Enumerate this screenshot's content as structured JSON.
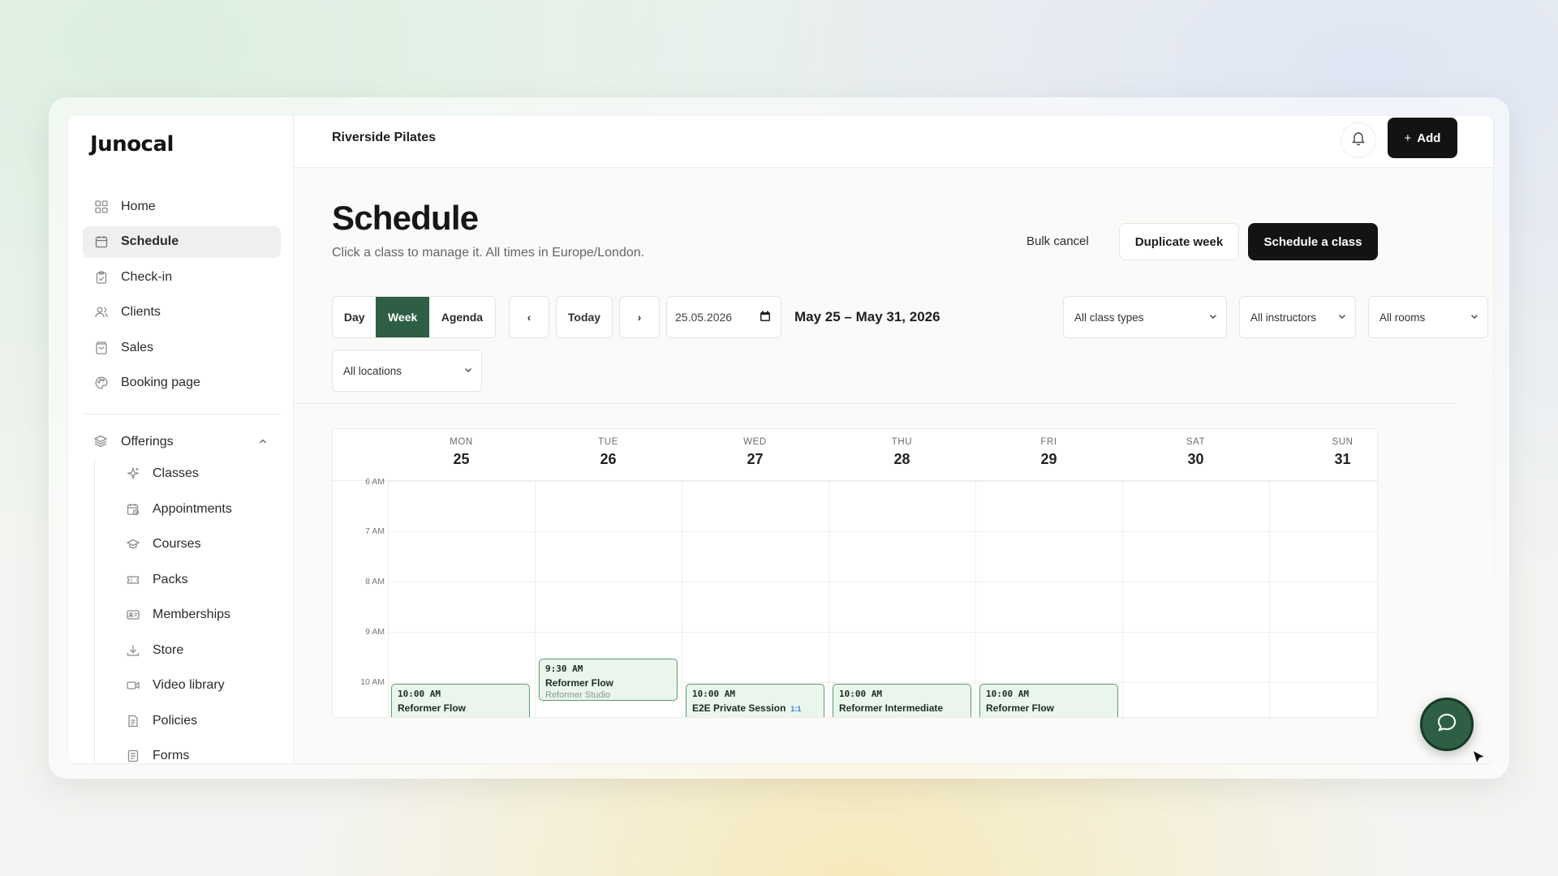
{
  "app": {
    "logo": "Junocal",
    "studio": "Riverside Pilates",
    "add_label": "Add"
  },
  "sidebar": {
    "items": [
      {
        "label": "Home",
        "icon": "grid-icon"
      },
      {
        "label": "Schedule",
        "icon": "calendar-icon",
        "active": true
      },
      {
        "label": "Check-in",
        "icon": "clipboard-icon"
      },
      {
        "label": "Clients",
        "icon": "users-icon"
      },
      {
        "label": "Sales",
        "icon": "bag-icon"
      },
      {
        "label": "Booking page",
        "icon": "palette-icon"
      }
    ],
    "group": {
      "label": "Offerings",
      "icon": "layers-icon"
    },
    "subitems": [
      {
        "label": "Classes",
        "icon": "sparkle-icon"
      },
      {
        "label": "Appointments",
        "icon": "calendar-clock-icon"
      },
      {
        "label": "Courses",
        "icon": "graduation-cap-icon"
      },
      {
        "label": "Packs",
        "icon": "ticket-icon"
      },
      {
        "label": "Memberships",
        "icon": "id-card-icon"
      },
      {
        "label": "Store",
        "icon": "download-icon"
      },
      {
        "label": "Video library",
        "icon": "video-icon"
      },
      {
        "label": "Policies",
        "icon": "document-icon"
      },
      {
        "label": "Forms",
        "icon": "form-icon"
      }
    ]
  },
  "page": {
    "title": "Schedule",
    "subtitle": "Click a class to manage it. All times in Europe/London.",
    "bulk_cancel": "Bulk cancel",
    "duplicate_week": "Duplicate week",
    "schedule_class": "Schedule a class"
  },
  "toolbar": {
    "views": [
      "Day",
      "Week",
      "Agenda"
    ],
    "active_view": "Week",
    "prev": "‹",
    "today": "Today",
    "next": "›",
    "date_value": "25.05.2026",
    "range": "May 25 – May 31, 2026",
    "filters": [
      "All class types",
      "All instructors",
      "All rooms",
      "All locations"
    ]
  },
  "calendar": {
    "days": [
      {
        "dow": "MON",
        "num": "25"
      },
      {
        "dow": "TUE",
        "num": "26"
      },
      {
        "dow": "WED",
        "num": "27"
      },
      {
        "dow": "THU",
        "num": "28"
      },
      {
        "dow": "FRI",
        "num": "29"
      },
      {
        "dow": "SAT",
        "num": "30"
      },
      {
        "dow": "SUN",
        "num": "31"
      }
    ],
    "hours": [
      "6 AM",
      "7 AM",
      "8 AM",
      "9 AM",
      "10 AM"
    ],
    "events": [
      {
        "day": 0,
        "time": "10:00 AM",
        "name": "Reformer Flow",
        "location": ""
      },
      {
        "day": 1,
        "time": "9:30 AM",
        "name": "Reformer Flow",
        "location": "Reformer Studio"
      },
      {
        "day": 2,
        "time": "10:00 AM",
        "name": "E2E Private Session",
        "badge": "1:1",
        "location": ""
      },
      {
        "day": 3,
        "time": "10:00 AM",
        "name": "Reformer Intermediate",
        "location": ""
      },
      {
        "day": 4,
        "time": "10:00 AM",
        "name": "Reformer Flow",
        "location": ""
      }
    ]
  },
  "colors": {
    "accent": "#2e5f45",
    "event_bg": "#eaf5ec",
    "event_border": "#5f9a73"
  }
}
